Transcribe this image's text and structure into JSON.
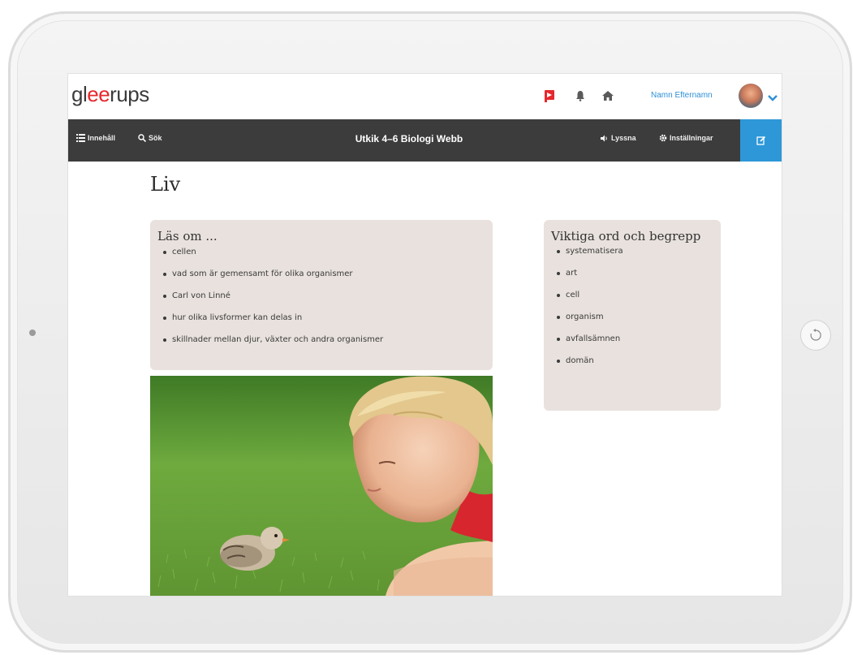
{
  "brand": {
    "logo_prefix": "gl",
    "logo_accent": "ee",
    "logo_suffix": "rups",
    "accent": "#e5282d"
  },
  "header": {
    "icons": [
      "flag-icon",
      "bell-icon",
      "home-icon"
    ],
    "user_name": "Namn Efternamn"
  },
  "navbar": {
    "contents_label": "Innehåll",
    "search_label": "Sök",
    "title": "Utkik 4–6 Biologi Webb",
    "listen_label": "Lyssna",
    "settings_label": "Inställningar",
    "background": "#3c3c3c",
    "edit_color": "#2d97d8"
  },
  "page": {
    "title": "Liv"
  },
  "read_about": {
    "heading": "Läs om ...",
    "items": [
      "cellen",
      "vad som är gemensamt för olika organismer",
      "Carl von Linné",
      "hur olika livsformer kan delas in",
      "skillnader mellan djur, växter och andra organismer"
    ]
  },
  "key_terms": {
    "heading": "Viktiga ord och begrepp",
    "items": [
      "systematisera",
      "art",
      "cell",
      "organism",
      "avfallsämnen",
      "domän"
    ]
  },
  "colors": {
    "box_bg": "#e8e1dd",
    "link": "#2e8fd6"
  }
}
